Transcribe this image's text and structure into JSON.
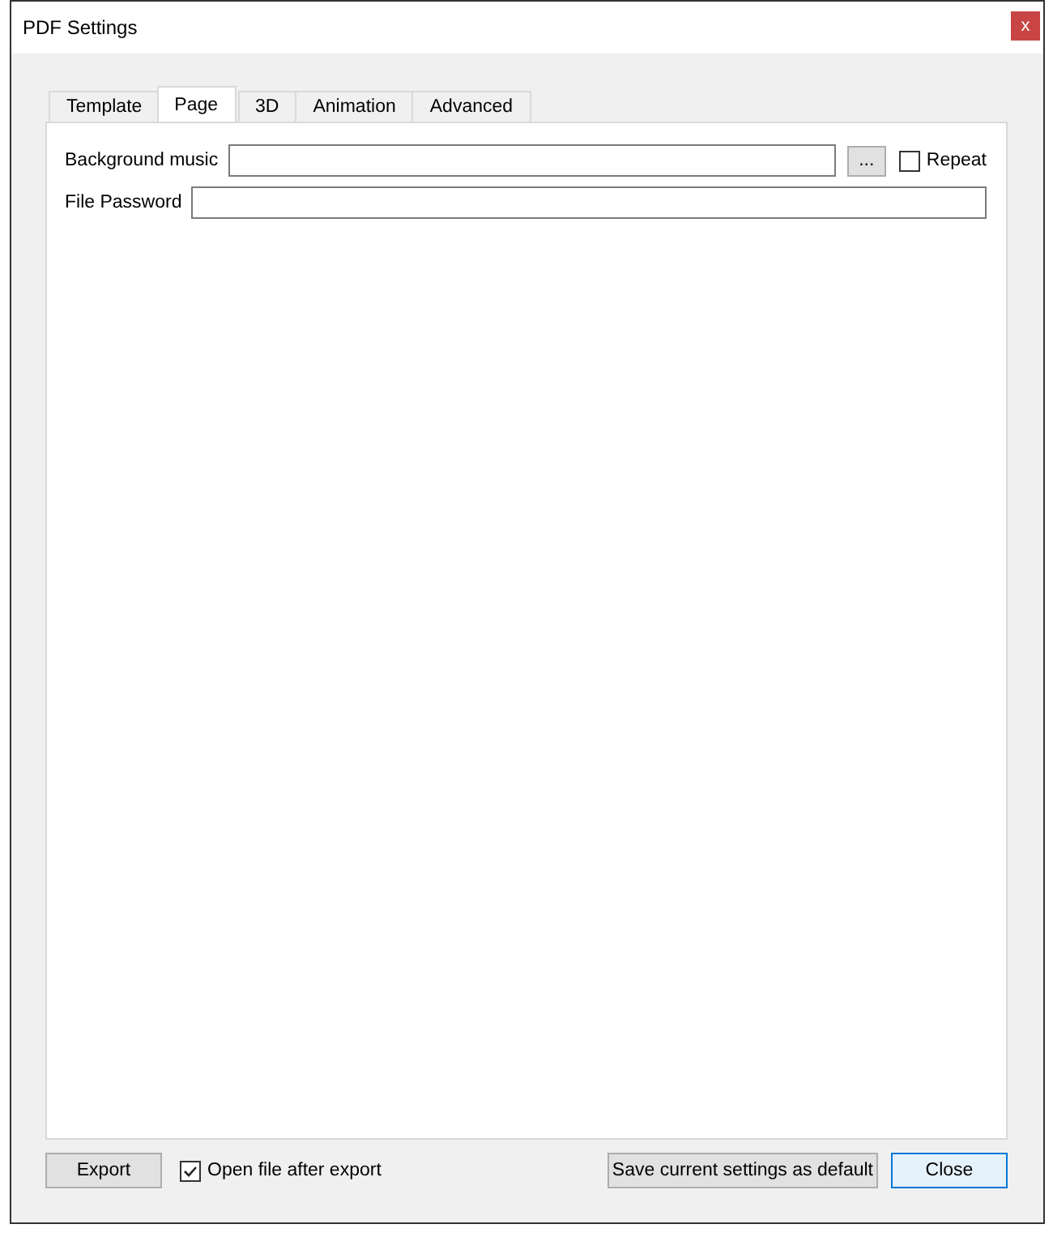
{
  "window": {
    "title": "PDF Settings",
    "close_label": "x"
  },
  "tabs": [
    {
      "label": "Template",
      "selected": false
    },
    {
      "label": "Page",
      "selected": true
    },
    {
      "label": "3D",
      "selected": false
    },
    {
      "label": "Animation",
      "selected": false
    },
    {
      "label": "Advanced",
      "selected": false
    }
  ],
  "page": {
    "background_music": {
      "label": "Background music",
      "browse_label": "...",
      "repeat_label": "Repeat",
      "repeat_checked": false
    },
    "file_password": {
      "label": "File Password"
    }
  },
  "footer": {
    "export_label": "Export",
    "open_after_label": "Open file after export",
    "open_after_checked": true,
    "save_default_label": "Save current settings as default",
    "close_label": "Close"
  }
}
